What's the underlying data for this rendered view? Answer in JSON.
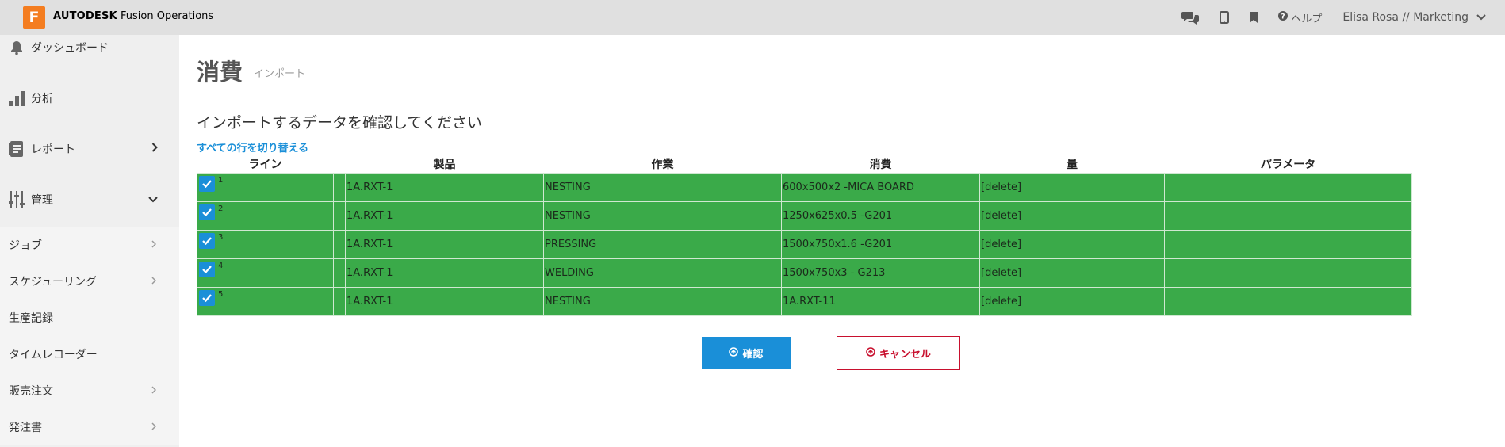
{
  "header": {
    "logo_letter": "F",
    "brand_bold": "AUTODESK",
    "brand_rest": " Fusion Operations",
    "help_label": "ヘルプ",
    "user_label": "Elisa Rosa // Marketing",
    "icons": [
      "chat-icon",
      "mobile-icon",
      "bookmark-icon",
      "help-icon",
      "chevron-down-icon"
    ]
  },
  "sidebar": {
    "items": [
      {
        "label": "ダッシュボード",
        "icon": "bell-icon"
      },
      {
        "label": "分析",
        "icon": "bar-chart-icon"
      },
      {
        "label": "レポート",
        "icon": "report-icon",
        "chevron": "›"
      },
      {
        "label": "管理",
        "icon": "sliders-icon",
        "chevron": "⌄"
      }
    ],
    "subitems": [
      {
        "label": "ジョブ",
        "chevron": "›"
      },
      {
        "label": "スケジューリング",
        "chevron": "›"
      },
      {
        "label": "生産記録"
      },
      {
        "label": "タイムレコーダー"
      },
      {
        "label": "販売注文",
        "chevron": "›"
      },
      {
        "label": "発注書",
        "chevron": "›"
      }
    ]
  },
  "page": {
    "title": "消費",
    "subtitle": "インポート",
    "heading": "インポートするデータを確認してください",
    "toggle_all": "すべての行を切り替える"
  },
  "table": {
    "columns": [
      "ライン",
      "",
      "製品",
      "作業",
      "消費",
      "量",
      "パラメータ"
    ],
    "rows": [
      {
        "line": "1",
        "product": "1A.RXT-1",
        "operation": "NESTING",
        "consumption": "600x500x2 -MICA BOARD",
        "quantity": "[delete]",
        "params": ""
      },
      {
        "line": "2",
        "product": "1A.RXT-1",
        "operation": "NESTING",
        "consumption": "1250x625x0.5 -G201",
        "quantity": "[delete]",
        "params": ""
      },
      {
        "line": "3",
        "product": "1A.RXT-1",
        "operation": "PRESSING",
        "consumption": "1500x750x1.6 -G201",
        "quantity": "[delete]",
        "params": ""
      },
      {
        "line": "4",
        "product": "1A.RXT-1",
        "operation": "WELDING",
        "consumption": "1500x750x3 - G213",
        "quantity": "[delete]",
        "params": ""
      },
      {
        "line": "5",
        "product": "1A.RXT-1",
        "operation": "NESTING",
        "consumption": "1A.RXT-11",
        "quantity": "[delete]",
        "params": ""
      }
    ],
    "row_color": "#3aaa49",
    "checkbox_color": "#1a8fd8"
  },
  "actions": {
    "confirm_label": "確認",
    "cancel_label": "キャンセル",
    "confirm_color": "#1a8fd8",
    "cancel_color": "#c8102e"
  }
}
